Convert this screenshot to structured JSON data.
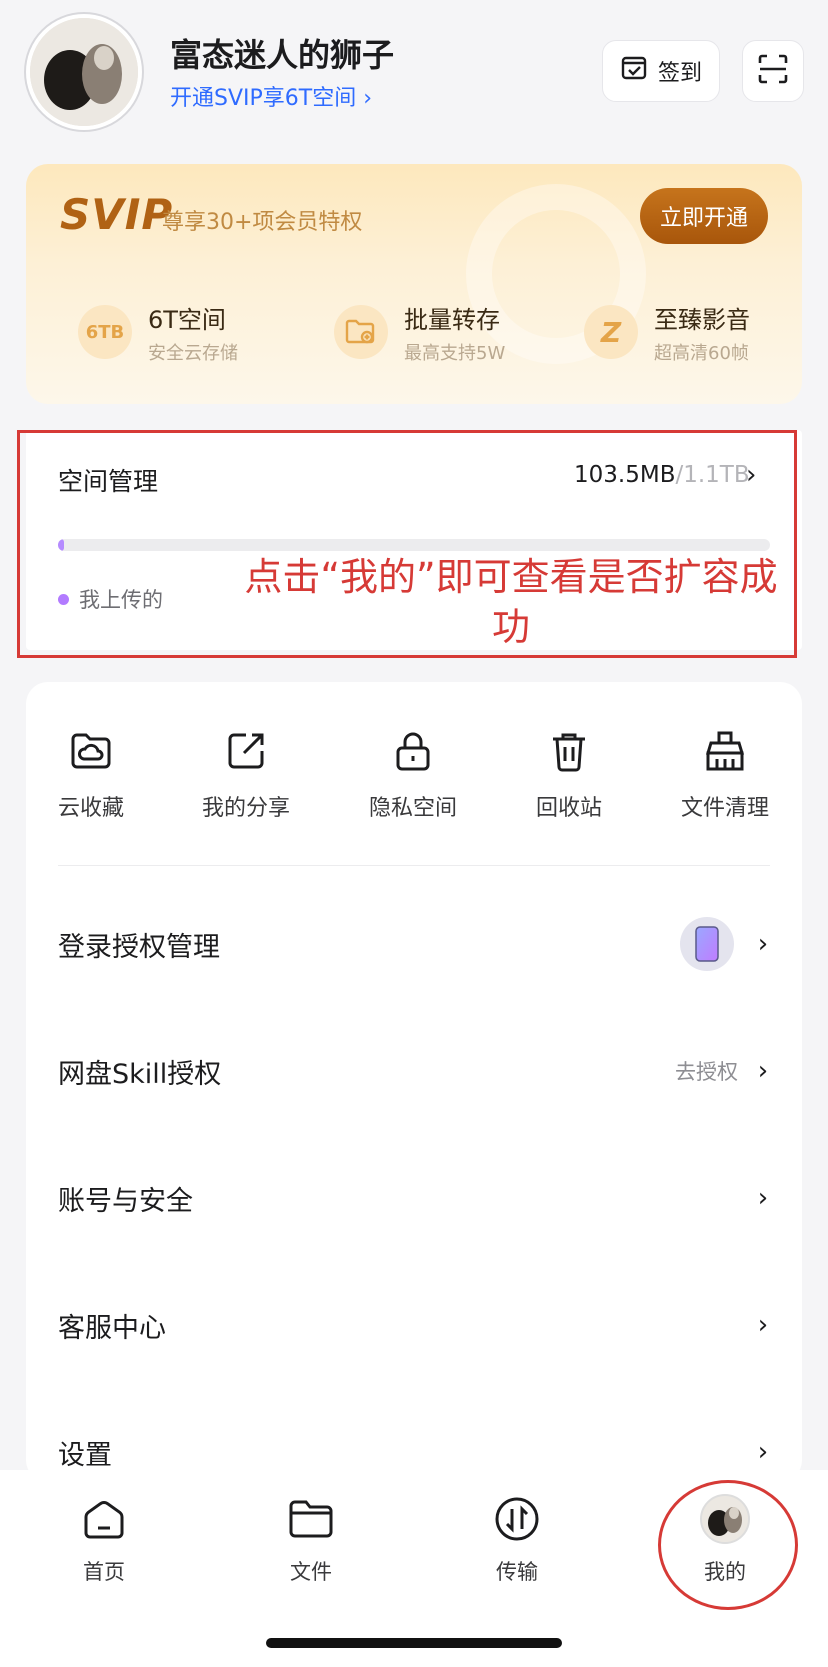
{
  "profile": {
    "username": "富态迷人的狮子",
    "svip_link": "开通SVIP享6T空间 ›"
  },
  "header": {
    "checkin_label": "签到"
  },
  "svip": {
    "logo": "SVIP",
    "tagline": "尊享30+项会员特权",
    "open_button": "立即开通",
    "perks": [
      {
        "icon_text": "6TB",
        "title": "6T空间",
        "subtitle": "安全云存储"
      },
      {
        "icon_text": "",
        "title": "批量转存",
        "subtitle": "最高支持5W"
      },
      {
        "icon_text": "Z",
        "title": "至臻影音",
        "subtitle": "超高清60帧"
      }
    ]
  },
  "storage": {
    "title": "空间管理",
    "used": "103.5MB",
    "total": "/1.1TB",
    "chevron": "›",
    "used_fraction": 0.0001,
    "legend": "我上传的",
    "annotation": "点击“我的”即可查看是否扩容成功"
  },
  "tools": [
    {
      "label": "云收藏",
      "icon": "cloud-folder-icon"
    },
    {
      "label": "我的分享",
      "icon": "share-icon"
    },
    {
      "label": "隐私空间",
      "icon": "lock-icon"
    },
    {
      "label": "回收站",
      "icon": "trash-icon"
    },
    {
      "label": "文件清理",
      "icon": "broom-icon"
    }
  ],
  "list": [
    {
      "label": "登录授权管理",
      "hint": "",
      "chevron": "›"
    },
    {
      "label": "网盘Skill授权",
      "hint": "去授权",
      "chevron": "›"
    },
    {
      "label": "账号与安全",
      "hint": "",
      "chevron": "›"
    },
    {
      "label": "客服中心",
      "hint": "",
      "chevron": "›"
    },
    {
      "label": "设置",
      "hint": "",
      "chevron": "›"
    }
  ],
  "tabs": [
    {
      "label": "首页",
      "icon": "home-icon"
    },
    {
      "label": "文件",
      "icon": "folder-icon"
    },
    {
      "label": "传输",
      "icon": "transfer-icon"
    },
    {
      "label": "我的",
      "icon": "avatar"
    }
  ],
  "colors": {
    "accent": "#2f6bff",
    "annotation_red": "#d63a36",
    "svip_brown": "#b06214",
    "progress_purple": "#b58bff"
  }
}
